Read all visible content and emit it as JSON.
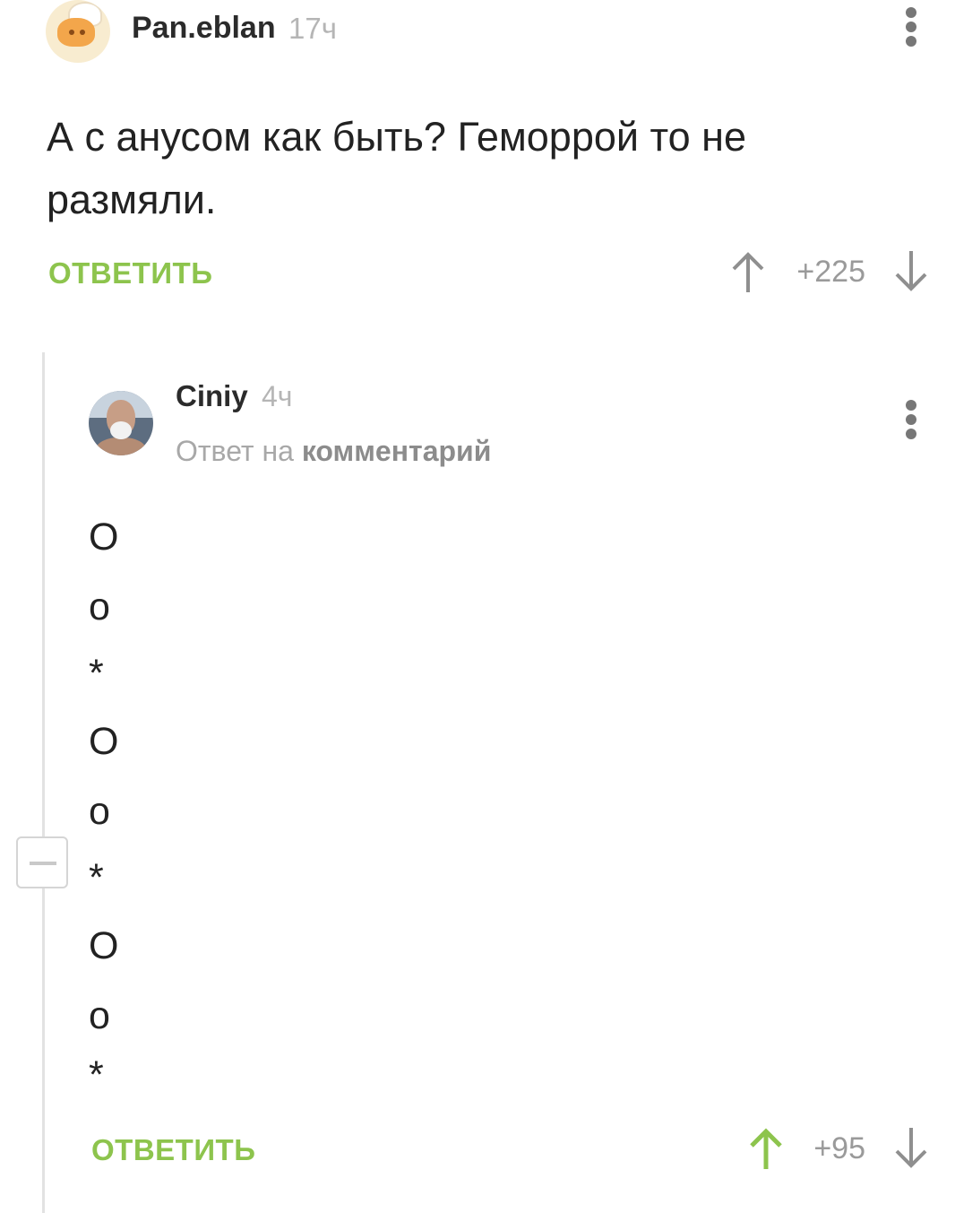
{
  "comment": {
    "username": "Pan.eblan",
    "time": "17ч",
    "text": "А с анусом как быть? Геморрой то не размяли.",
    "reply_label": "ОТВЕТИТЬ",
    "score": "+225"
  },
  "reply": {
    "username": "Ciniy",
    "time": "4ч",
    "reply_prefix": "Ответ на",
    "reply_target": "комментарий",
    "lines": [
      "O",
      "o",
      "*",
      "O",
      "o",
      "*",
      "O",
      "o",
      "*"
    ],
    "reply_label": "ОТВЕТИТЬ",
    "score": "+95"
  },
  "colors": {
    "accent_green": "#8dc44d",
    "muted_gray": "#9a9a9a"
  },
  "icons": [
    "avatar-icon",
    "more-options-icon",
    "upvote-arrow-icon",
    "downvote-arrow-icon",
    "collapse-icon"
  ]
}
